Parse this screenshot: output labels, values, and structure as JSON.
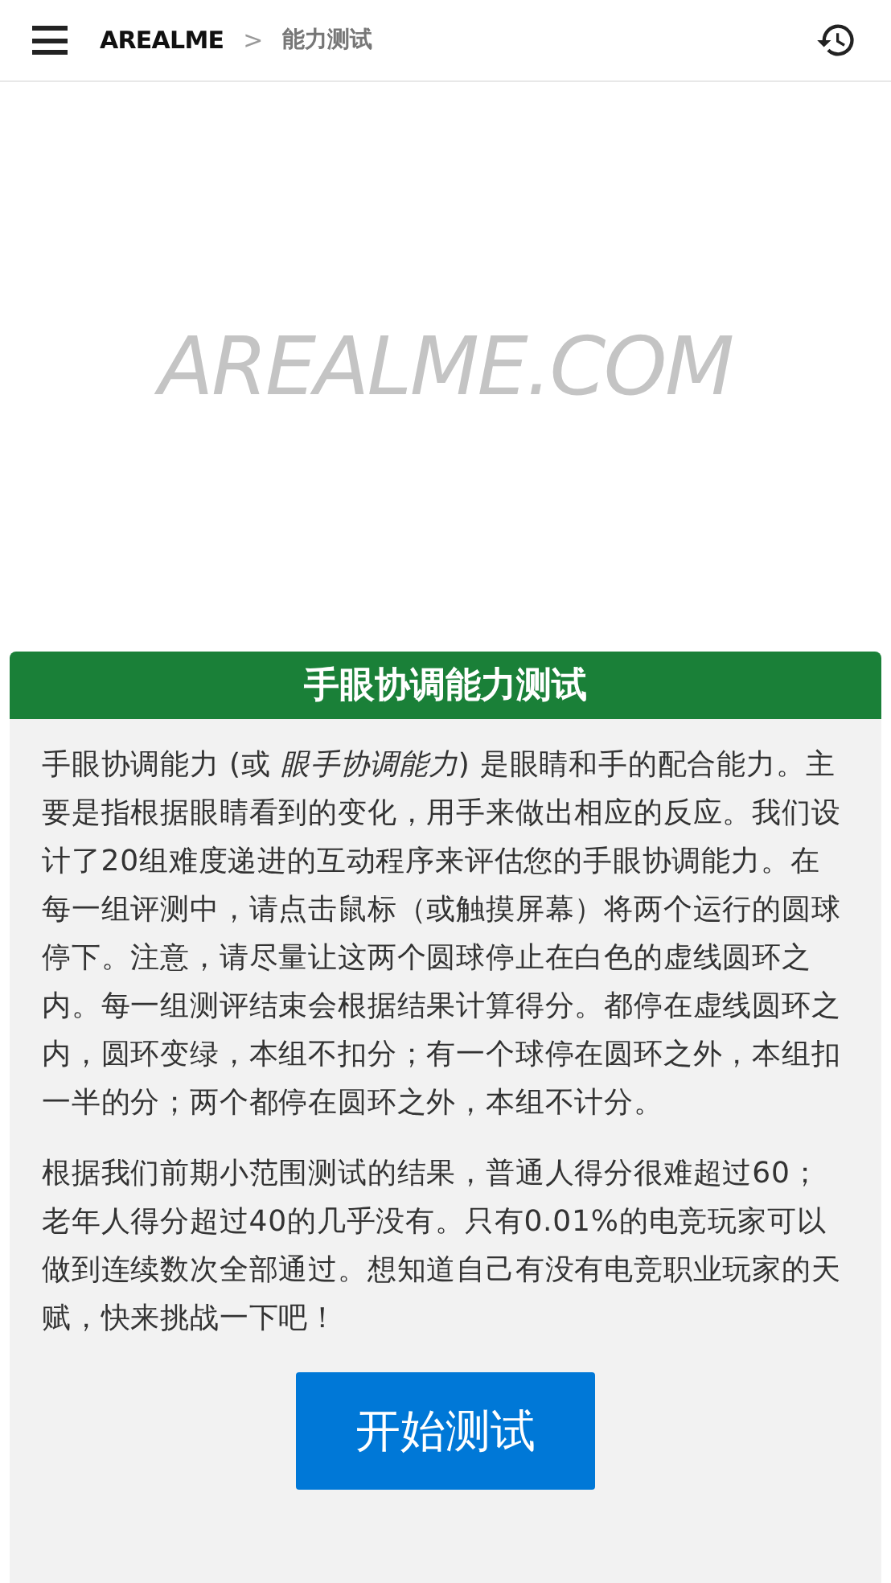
{
  "header": {
    "brand": "AREALME",
    "separator": ">",
    "current": "能力测试"
  },
  "ad_area": {
    "text": "AREALME.COM"
  },
  "card": {
    "title": "手眼协调能力测试",
    "paragraphs": [
      "手眼协调能力 (或 *眼手协调能力*) 是眼睛和手的配合能力。主要是指根据眼睛看到的变化，用手来做出相应的反应。我们设计了20组难度递进的互动程序来评估您的手眼协调能力。在每一组评测中，请点击鼠标（或触摸屏幕）将两个运行的圆球停下。注意，请尽量让这两个圆球停止在白色的虚线圆环之内。每一组测评结束会根据结果计算得分。都停在虚线圆环之内，圆环变绿，本组不扣分；有一个球停在圆环之外，本组扣一半的分；两个都停在圆环之外，本组不计分。",
      "根据我们前期小范围测试的结果，普通人得分很难超过60；老年人得分超过40的几乎没有。只有0.01%的电竞玩家可以做到连续数次全部通过。想知道自己有没有电竞职业玩家的天赋，快来挑战一下吧！"
    ],
    "button": "开始测试"
  }
}
